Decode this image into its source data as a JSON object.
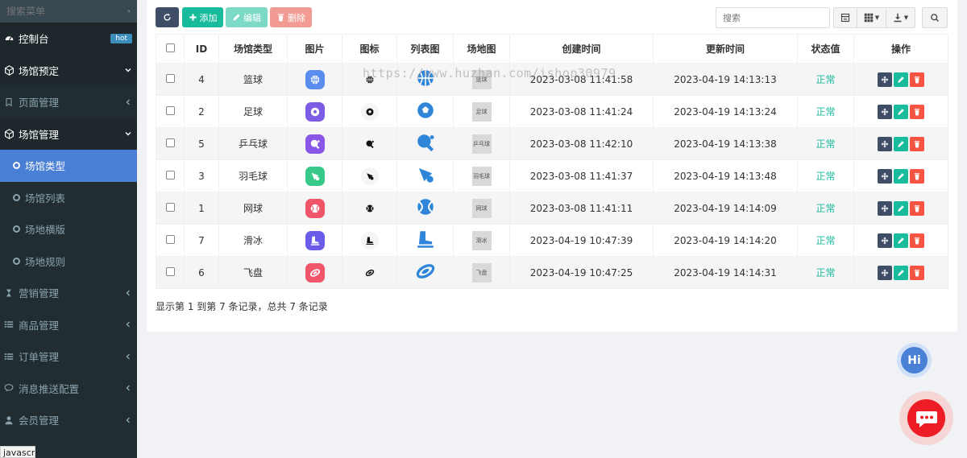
{
  "sidebar": {
    "search_placeholder": "搜索菜单",
    "items": [
      {
        "label": "控制台",
        "badge": "hot"
      },
      {
        "label": "场馆预定"
      },
      {
        "label": "页面管理"
      },
      {
        "label": "场馆管理"
      },
      {
        "label": "场馆类型"
      },
      {
        "label": "场馆列表"
      },
      {
        "label": "场地横版"
      },
      {
        "label": "场地规则"
      },
      {
        "label": "营销管理"
      },
      {
        "label": "商品管理"
      },
      {
        "label": "订单管理"
      },
      {
        "label": "消息推送配置"
      },
      {
        "label": "会员管理"
      }
    ]
  },
  "status_tip": "javascript:;",
  "toolbar": {
    "add_label": "添加",
    "edit_label": "编辑",
    "delete_label": "删除",
    "search_placeholder": "搜索"
  },
  "table": {
    "headers": [
      "ID",
      "场馆类型",
      "图片",
      "图标",
      "列表图",
      "场地图",
      "创建时间",
      "更新时间",
      "状态值",
      "操作"
    ],
    "rows": [
      {
        "id": "4",
        "type": "篮球",
        "map": "篮球",
        "created": "2023-03-08 11:41:58",
        "updated": "2023-04-19 14:13:13",
        "status": "正常",
        "color": "#5b8def",
        "icon": "basketball"
      },
      {
        "id": "2",
        "type": "足球",
        "map": "足球",
        "created": "2023-03-08 11:41:24",
        "updated": "2023-04-19 14:13:24",
        "status": "正常",
        "color": "#7b5ce5",
        "icon": "soccer"
      },
      {
        "id": "5",
        "type": "乒乓球",
        "map": "乒乓球",
        "created": "2023-03-08 11:42:10",
        "updated": "2023-04-19 14:13:38",
        "status": "正常",
        "color": "#8a56e8",
        "icon": "pingpong"
      },
      {
        "id": "3",
        "type": "羽毛球",
        "map": "羽毛球",
        "created": "2023-03-08 11:41:37",
        "updated": "2023-04-19 14:13:48",
        "status": "正常",
        "color": "#36c98a",
        "icon": "badminton"
      },
      {
        "id": "1",
        "type": "网球",
        "map": "网球",
        "created": "2023-03-08 11:41:11",
        "updated": "2023-04-19 14:14:09",
        "status": "正常",
        "color": "#f0556a",
        "icon": "tennis"
      },
      {
        "id": "7",
        "type": "滑冰",
        "map": "滑冰",
        "created": "2023-04-19 10:47:39",
        "updated": "2023-04-19 14:14:20",
        "status": "正常",
        "color": "#6a5ce8",
        "icon": "skate"
      },
      {
        "id": "6",
        "type": "飞盘",
        "map": "飞盘",
        "created": "2023-04-19 10:47:25",
        "updated": "2023-04-19 14:14:31",
        "status": "正常",
        "color": "#f0556a",
        "icon": "frisbee"
      }
    ]
  },
  "page_info": "显示第 1 到第 7 条记录，总共 7 条记录",
  "watermark": "https://www.huzhan.com/ishop30979",
  "hi_label": "Hi",
  "colors": {
    "accent_blue": "#4a7fd6",
    "teal": "#18bc9c",
    "list_icon_blue": "#2f86d9"
  }
}
